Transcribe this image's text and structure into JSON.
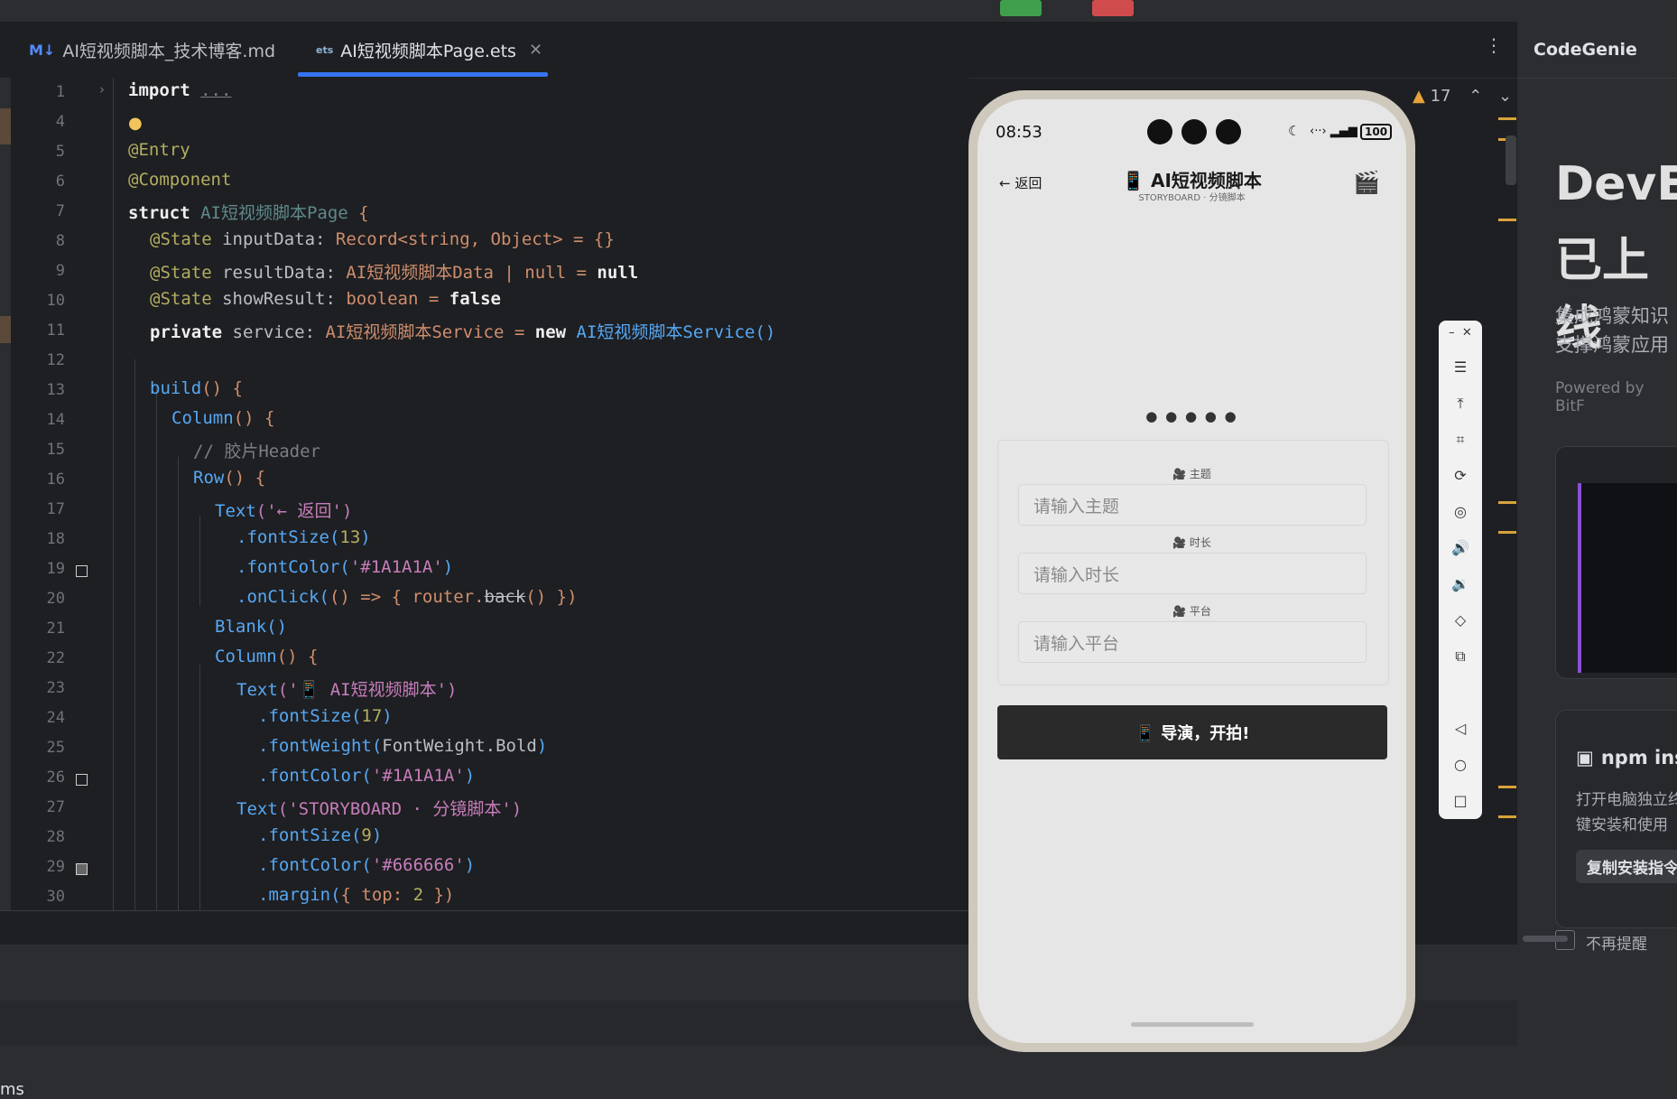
{
  "tabs": [
    {
      "icon": "M↓",
      "label": "AI短视频脚本_技术博客.md"
    },
    {
      "icon": "ets",
      "label": "AI短视频脚本Page.ets"
    }
  ],
  "editor": {
    "warning_count": "17",
    "lines": [
      {
        "n": "1"
      },
      {
        "n": "4"
      },
      {
        "n": "5"
      },
      {
        "n": "6"
      },
      {
        "n": "7"
      },
      {
        "n": "8"
      },
      {
        "n": "9"
      },
      {
        "n": "10"
      },
      {
        "n": "11"
      },
      {
        "n": "12"
      },
      {
        "n": "13"
      },
      {
        "n": "14"
      },
      {
        "n": "15"
      },
      {
        "n": "16"
      },
      {
        "n": "17"
      },
      {
        "n": "18"
      },
      {
        "n": "19"
      },
      {
        "n": "20"
      },
      {
        "n": "21"
      },
      {
        "n": "22"
      },
      {
        "n": "23"
      },
      {
        "n": "24"
      },
      {
        "n": "25"
      },
      {
        "n": "26"
      },
      {
        "n": "27"
      },
      {
        "n": "28"
      },
      {
        "n": "29"
      },
      {
        "n": "30"
      }
    ],
    "code": {
      "l1_kw": "import",
      "l1_fold": "...",
      "l5": "@Entry",
      "l6": "@Component",
      "l7_kw": "struct",
      "l7_name": "AI短视频脚本Page",
      "l7_brace": " {",
      "l8_a": "@State",
      "l8_b": " inputData: ",
      "l8_c": "Record<string, Object>",
      "l8_d": " = {}",
      "l9_a": "@State",
      "l9_b": " resultData: ",
      "l9_c": "AI短视频脚本Data | null",
      "l9_d": " = ",
      "l9_e": "null",
      "l10_a": "@State",
      "l10_b": " showResult: ",
      "l10_c": "boolean",
      "l10_d": " = ",
      "l10_e": "false",
      "l11_a": "private",
      "l11_b": " service: ",
      "l11_c": "AI短视频脚本Service",
      "l11_d": " = ",
      "l11_e": "new",
      "l11_f": " AI短视频脚本Service()",
      "l13_a": "build",
      "l13_b": "() {",
      "l14_a": "Column",
      "l14_b": "() {",
      "l15": "// 胶片Header",
      "l16_a": "Row",
      "l16_b": "() {",
      "l17_a": "Text",
      "l17_b": "('← 返回')",
      "l18_a": ".fontSize(",
      "l18_b": "13",
      "l18_c": ")",
      "l19_a": ".fontColor(",
      "l19_b": "'#1A1A1A'",
      "l19_c": ")",
      "l20_a": ".onClick(",
      "l20_b": "() => { router.",
      "l20_c": "back",
      "l20_d": "() })",
      "l21": "Blank()",
      "l22_a": "Column",
      "l22_b": "() {",
      "l23_a": "Text",
      "l23_b": "('📱 AI短视频脚本')",
      "l24_a": ".fontSize(",
      "l24_b": "17",
      "l24_c": ")",
      "l25_a": ".fontWeight(",
      "l25_b": "FontWeight.Bold",
      "l25_c": ")",
      "l26_a": ".fontColor(",
      "l26_b": "'#1A1A1A'",
      "l26_c": ")",
      "l27_a": "Text",
      "l27_b": "('STORYBOARD · 分镜脚本')",
      "l28_a": ".fontSize(",
      "l28_b": "9",
      "l28_c": ")",
      "l29_a": ".fontColor(",
      "l29_b": "'#666666'",
      "l29_c": ")",
      "l30_a": ".margin(",
      "l30_b": "{ top: ",
      "l30_c": "2",
      "l30_d": " })"
    }
  },
  "phone": {
    "time": "08:53",
    "battery": "100",
    "back_label": "← 返回",
    "title": "📱 AI短视频脚本",
    "subtitle": "STORYBOARD · 分镜脚本",
    "clapper": "🎬",
    "dots": "● ● ● ● ●",
    "fields": [
      {
        "label": "🎥 主题",
        "placeholder": "请输入主题"
      },
      {
        "label": "🎥 时长",
        "placeholder": "请输入时长"
      },
      {
        "label": "🎥 平台",
        "placeholder": "请输入平台"
      }
    ],
    "action_button": "📱 导演，开拍!"
  },
  "right_panel": {
    "title": "CodeGenie",
    "hero_line1": "DevEc",
    "hero_line2": "已上线",
    "desc1": "集成鸿蒙知识",
    "desc2": "支撑鸿蒙应用",
    "powered": "Powered by BitF",
    "npm_title": "npm ins",
    "npm_desc1": "打开电脑独立终",
    "npm_desc2": "键安装和使用",
    "copy_btn": "复制安装指令",
    "no_remind": "不再提醒"
  },
  "bottom": {
    "status_text": "ms"
  },
  "colors": {
    "accent": "#3574f0",
    "editor_bg": "#1e1f22",
    "phone_button": "#2a2a2a"
  }
}
